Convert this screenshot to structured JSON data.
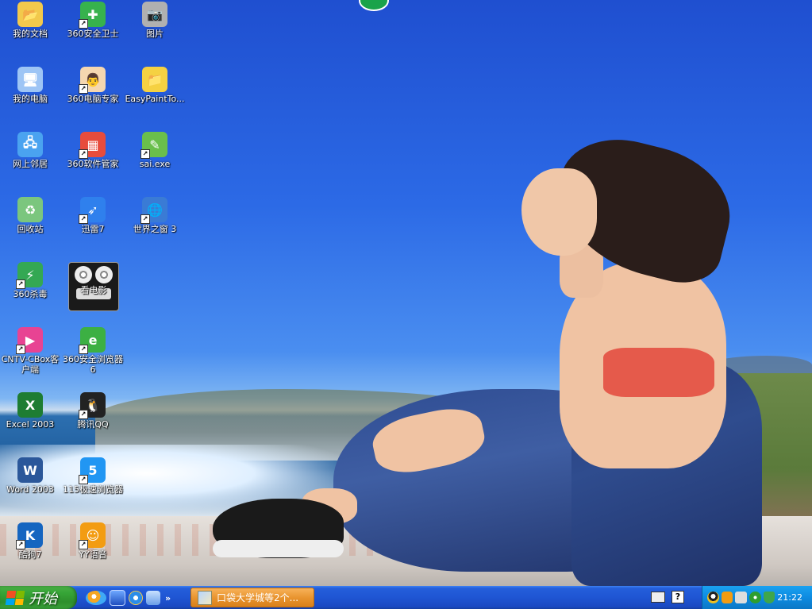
{
  "desktop": {
    "icons": [
      {
        "id": "my-documents",
        "label": "我的文档",
        "color": "#f2c94c",
        "glyph": "📂"
      },
      {
        "id": "360-safe",
        "label": "360安全卫士",
        "color": "#37b24d",
        "glyph": "✚"
      },
      {
        "id": "pictures",
        "label": "图片",
        "color": "#b0b0b0",
        "glyph": "📷"
      },
      {
        "id": "my-computer",
        "label": "我的电脑",
        "color": "#9ec5f5",
        "glyph": "🖥"
      },
      {
        "id": "360-computer-expert",
        "label": "360电脑专家",
        "color": "#f5d7b0",
        "glyph": "👨"
      },
      {
        "id": "easypainttool",
        "label": "EasyPaintTo...",
        "color": "#f5d142",
        "glyph": "📁"
      },
      {
        "id": "network-places",
        "label": "网上邻居",
        "color": "#4aa3f0",
        "glyph": "🖧"
      },
      {
        "id": "360-software-manager",
        "label": "360软件管家",
        "color": "#e74c3c",
        "glyph": "▦"
      },
      {
        "id": "sai",
        "label": "sai.exe",
        "color": "#6abf4b",
        "glyph": "✎"
      },
      {
        "id": "recycle-bin",
        "label": "回收站",
        "color": "#7bc67e",
        "glyph": "♻"
      },
      {
        "id": "xunlei",
        "label": "迅雷7",
        "color": "#2f80ed",
        "glyph": "➶"
      },
      {
        "id": "theworld",
        "label": "世界之窗 3",
        "color": "#3a7bd5",
        "glyph": "🌐"
      },
      {
        "id": "360-antivirus",
        "label": "360杀毒",
        "color": "#34a853",
        "glyph": "⚡"
      },
      {
        "id": "kandianying",
        "label": "看电影",
        "color": "#1a1a1a",
        "glyph": ""
      },
      {
        "id": "cntv-cbox",
        "label": "CNTV-CBox客户端",
        "color": "#e84393",
        "glyph": "▶"
      },
      {
        "id": "360-browser",
        "label": "360安全浏览器6",
        "color": "#3cb043",
        "glyph": "e"
      },
      {
        "id": "excel-2003",
        "label": "Excel 2003",
        "color": "#1e7d32",
        "glyph": "X"
      },
      {
        "id": "qq",
        "label": "腾讯QQ",
        "color": "#222222",
        "glyph": "🐧"
      },
      {
        "id": "word-2003",
        "label": "Word 2003",
        "color": "#2b579a",
        "glyph": "W"
      },
      {
        "id": "115-browser",
        "label": "115极速浏览器",
        "color": "#2196f3",
        "glyph": "5"
      },
      {
        "id": "kugou",
        "label": "酷狗7",
        "color": "#1565c0",
        "glyph": "K"
      },
      {
        "id": "yy",
        "label": "YY语音",
        "color": "#f39c12",
        "glyph": "☺"
      }
    ]
  },
  "taskbar": {
    "start_label": "开始",
    "quicklaunch_more": "»",
    "task_item_label": "口袋大学城等2个...",
    "help_label": "?",
    "clock": "21:22"
  }
}
